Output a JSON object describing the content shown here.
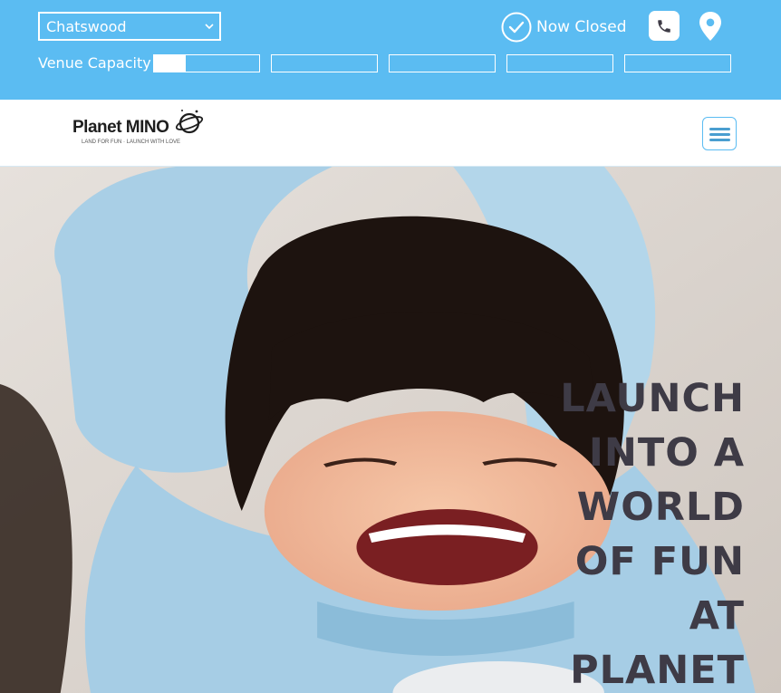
{
  "topbar": {
    "location": "Chatswood",
    "status": "Now Closed",
    "capacity_label": "Venue Capacity",
    "capacity_segments": [
      {
        "fill": 0.3
      },
      {
        "fill": 0
      },
      {
        "fill": 0
      },
      {
        "fill": 0
      },
      {
        "fill": 0
      }
    ],
    "icons": {
      "clock": "clock-icon",
      "phone": "phone-icon",
      "pin": "location-pin-icon",
      "dropdown": "chevron-down-icon"
    }
  },
  "navbar": {
    "logo_text": "Planet MINO",
    "logo_tagline": "LAND FOR FUN · LAUNCH WITH LOVE",
    "menu_icon": "hamburger-menu-icon"
  },
  "hero": {
    "heading_lines": [
      "LAUNCH",
      "INTO A",
      "WORLD",
      "OF FUN",
      "AT",
      "PLANET"
    ],
    "image": "child-excited-photo"
  },
  "colors": {
    "brand_blue": "#5bbcf2",
    "heading": "#3e3b46",
    "white": "#ffffff"
  }
}
